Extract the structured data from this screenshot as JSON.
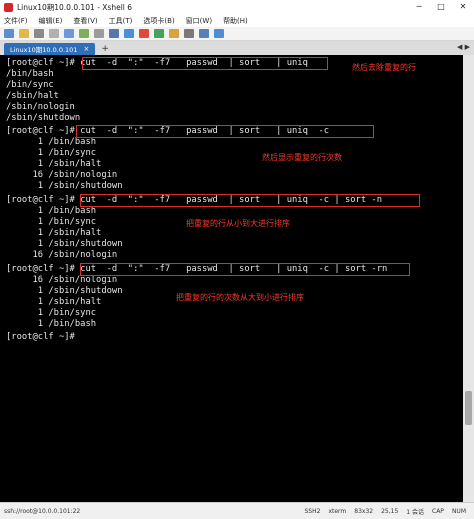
{
  "window": {
    "title": "Linux10期10.0.0.101 - Xshell 6",
    "minimize": "─",
    "maximize": "□",
    "close": "✕"
  },
  "menu": [
    "文件(F)",
    "编辑(E)",
    "查看(V)",
    "工具(T)",
    "选项卡(B)",
    "窗口(W)",
    "帮助(H)"
  ],
  "tab": {
    "label": "Linux10期10.0.0.101",
    "close": "×",
    "add": "+",
    "nav": "◀ ▶"
  },
  "terminal": {
    "lines": [
      "[root@clf ~]# cut  -d  \":\"  -f7   passwd  | sort   | uniq",
      "/bin/bash",
      "/bin/sync",
      "/sbin/halt",
      "/sbin/nologin",
      "/sbin/shutdown",
      "[root@clf ~]# cut  -d  \":\"  -f7   passwd  | sort   | uniq  -c",
      "      1 /bin/bash",
      "      1 /bin/sync",
      "      1 /sbin/halt",
      "     16 /sbin/nologin",
      "      1 /sbin/shutdown",
      "[root@clf ~]# cut  -d  \":\"  -f7   passwd  | sort   | uniq  -c | sort -n",
      "      1 /bin/bash",
      "      1 /bin/sync",
      "      1 /sbin/halt",
      "      1 /sbin/shutdown",
      "     16 /sbin/nologin",
      "[root@clf ~]# cut  -d  \":\"  -f7   passwd  | sort   | uniq  -c | sort -rn",
      "     16 /sbin/nologin",
      "      1 /sbin/shutdown",
      "      1 /sbin/halt",
      "      1 /bin/sync",
      "      1 /bin/bash",
      "[root@clf ~]# "
    ],
    "annotations": [
      "然后去除重复的行",
      "然后显示重复的行次数",
      "把重复的行从小到大进行排序",
      "把重复的行的次数从大到小进行排序"
    ],
    "colors": {
      "background": "#000000",
      "text": "#e6e6e6",
      "annotation": "#ff3a2a"
    }
  },
  "status": {
    "connection": "ssh://root@10.0.0.101:22",
    "protocol": "SSH2",
    "terminal_type": "xterm",
    "size": "83x32",
    "cursor": "25,15",
    "sessions": "1 会话",
    "caps": "CAP",
    "num": "NUM"
  }
}
